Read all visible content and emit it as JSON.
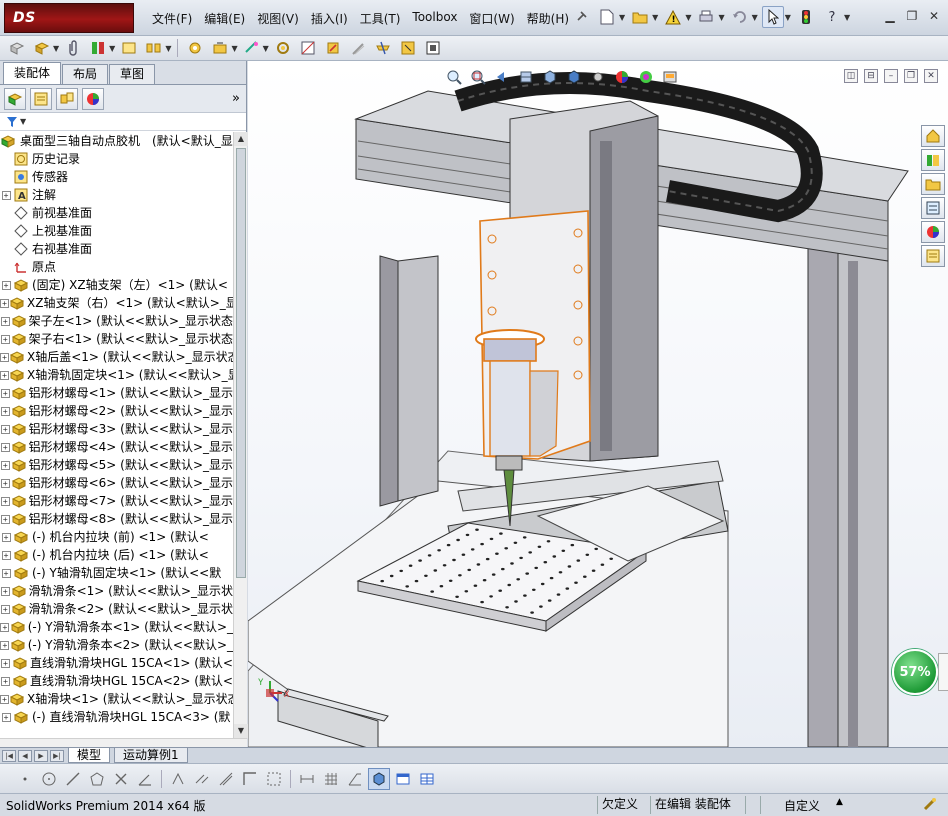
{
  "app": {
    "brand": "DS SOLIDWORKS",
    "title": "SolidWorks Premium 2014 x64 版"
  },
  "menu": [
    "文件(F)",
    "编辑(E)",
    "视图(V)",
    "插入(I)",
    "工具(T)",
    "Toolbox",
    "窗口(W)",
    "帮助(H)"
  ],
  "manager_tabs": [
    "装配体",
    "布局",
    "草图"
  ],
  "tree": {
    "root": "桌面型三轴自动点胶机　(默认<默认_显",
    "items": [
      {
        "label": "历史记录",
        "icon": "history-icon",
        "expandable": false
      },
      {
        "label": "传感器",
        "icon": "sensor-icon",
        "expandable": false
      },
      {
        "label": "注解",
        "icon": "annotation-icon",
        "expandable": true
      },
      {
        "label": "前视基准面",
        "icon": "plane-icon",
        "expandable": false
      },
      {
        "label": "上视基准面",
        "icon": "plane-icon",
        "expandable": false
      },
      {
        "label": "右视基准面",
        "icon": "plane-icon",
        "expandable": false
      },
      {
        "label": "原点",
        "icon": "origin-icon",
        "expandable": false
      },
      {
        "label": "(固定) XZ轴支架（左）<1> (默认<",
        "icon": "part-icon",
        "expandable": true
      },
      {
        "label": "XZ轴支架（右）<1> (默认<默认>_显",
        "icon": "part-icon",
        "expandable": true
      },
      {
        "label": "架子左<1> (默认<<默认>_显示状态",
        "icon": "part-icon",
        "expandable": true
      },
      {
        "label": "架子右<1> (默认<<默认>_显示状态",
        "icon": "part-icon",
        "expandable": true
      },
      {
        "label": "X轴后盖<1> (默认<<默认>_显示状态",
        "icon": "part-icon",
        "expandable": true
      },
      {
        "label": "X轴滑轨固定块<1> (默认<<默认>_显",
        "icon": "part-icon",
        "expandable": true
      },
      {
        "label": "铝形材螺母<1> (默认<<默认>_显示",
        "icon": "part-icon",
        "expandable": true
      },
      {
        "label": "铝形材螺母<2> (默认<<默认>_显示",
        "icon": "part-icon",
        "expandable": true
      },
      {
        "label": "铝形材螺母<3> (默认<<默认>_显示",
        "icon": "part-icon",
        "expandable": true
      },
      {
        "label": "铝形材螺母<4> (默认<<默认>_显示",
        "icon": "part-icon",
        "expandable": true
      },
      {
        "label": "铝形材螺母<5> (默认<<默认>_显示",
        "icon": "part-icon",
        "expandable": true
      },
      {
        "label": "铝形材螺母<6> (默认<<默认>_显示",
        "icon": "part-icon",
        "expandable": true
      },
      {
        "label": "铝形材螺母<7> (默认<<默认>_显示",
        "icon": "part-icon",
        "expandable": true
      },
      {
        "label": "铝形材螺母<8> (默认<<默认>_显示",
        "icon": "part-icon",
        "expandable": true
      },
      {
        "label": "(-) 机台内拉块 (前) <1> (默认<",
        "icon": "part-icon",
        "expandable": true
      },
      {
        "label": "(-) 机台内拉块 (后) <1> (默认<",
        "icon": "part-icon",
        "expandable": true
      },
      {
        "label": "(-) Y轴滑轨固定块<1> (默认<<默",
        "icon": "part-icon",
        "expandable": true
      },
      {
        "label": "滑轨滑条<1> (默认<<默认>_显示状",
        "icon": "part-icon",
        "expandable": true
      },
      {
        "label": "滑轨滑条<2> (默认<<默认>_显示状",
        "icon": "part-icon",
        "expandable": true
      },
      {
        "label": "(-) Y滑轨滑条本<1> (默认<<默认>_",
        "icon": "part-icon",
        "expandable": true
      },
      {
        "label": "(-) Y滑轨滑条本<2> (默认<<默认>_",
        "icon": "part-icon",
        "expandable": true
      },
      {
        "label": "直线滑轨滑块HGL 15CA<1> (默认<",
        "icon": "part-icon",
        "expandable": true
      },
      {
        "label": "直线滑轨滑块HGL 15CA<2> (默认<",
        "icon": "part-icon",
        "expandable": true
      },
      {
        "label": "X轴滑块<1> (默认<<默认>_显示状态",
        "icon": "part-icon",
        "expandable": true
      },
      {
        "label": "(-) 直线滑轨滑块HGL 15CA<3> (默",
        "icon": "part-icon",
        "expandable": true
      }
    ]
  },
  "bottom_tabs": [
    "模型",
    "运动算例1"
  ],
  "viewport": {
    "progress_label": "57%",
    "triad_y": "Y",
    "triad_x": "X"
  },
  "status": {
    "app_version": "SolidWorks Premium 2014 x64 版",
    "definition": "欠定义",
    "mode": "在编辑 装配体",
    "units": "自定义"
  },
  "colors": {
    "brand_red": "#a01616",
    "progress_green": "#1e9a36",
    "selection_orange": "#e07a1a",
    "part_yellow": "#e8c030"
  }
}
